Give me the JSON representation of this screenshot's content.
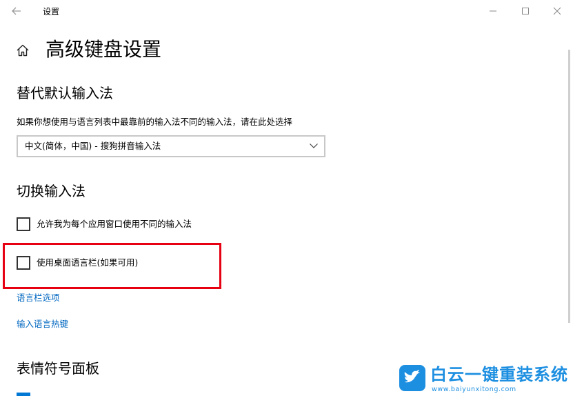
{
  "window": {
    "app_title": "设置"
  },
  "page": {
    "title": "高级键盘设置"
  },
  "override_input": {
    "heading": "替代默认输入法",
    "description": "如果你想使用与语言列表中最靠前的输入法不同的输入法，请在此处选择",
    "selected_value": "中文(简体，中国) - 搜狗拼音输入法"
  },
  "switch_input": {
    "heading": "切换输入法",
    "per_app_label": "允许我为每个应用窗口使用不同的输入法",
    "per_app_checked": false,
    "desktop_bar_label": "使用桌面语言栏(如果可用)",
    "desktop_bar_checked": false,
    "language_bar_options_link": "语言栏选项",
    "hotkeys_link": "输入语言热键"
  },
  "emoji_panel": {
    "heading": "表情符号面板"
  },
  "watermark": {
    "name": "白云一键重装系统",
    "url": "www.baiyunxitong.com"
  },
  "colors": {
    "link": "#0067c0",
    "highlight": "#e60012",
    "accent": "#0078d4",
    "watermark": "#1d8fe1"
  },
  "icons": [
    "back-arrow-icon",
    "home-icon",
    "chevron-down-icon",
    "minimize-icon",
    "maximize-icon",
    "close-icon",
    "bird-logo-icon"
  ]
}
